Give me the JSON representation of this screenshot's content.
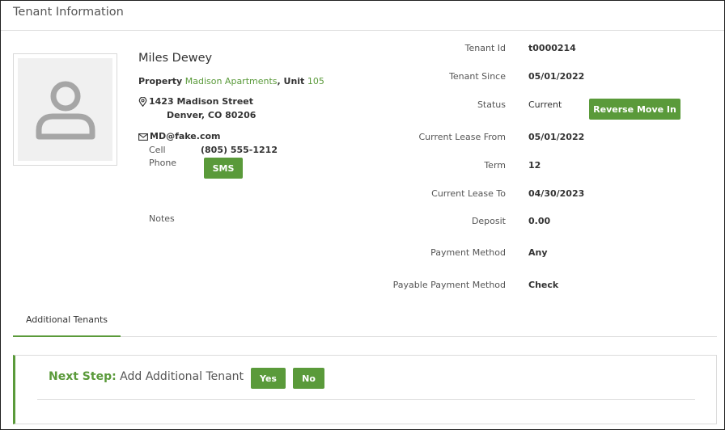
{
  "header": {
    "title": "Tenant Information"
  },
  "profile": {
    "name": "Miles Dewey",
    "property_label": "Property",
    "property_name": "Madison Apartments",
    "unit_label": ", Unit",
    "unit_number": "105",
    "address_line1": "1423 Madison Street",
    "address_line2": "Denver, CO 80206",
    "email": "MD@fake.com",
    "cell_label": "Cell",
    "cell_value": "(805) 555-1212",
    "phone_label": "Phone",
    "sms_button": "SMS",
    "notes_label": "Notes"
  },
  "details": [
    {
      "label": "Tenant Id",
      "value": "t0000214"
    },
    {
      "label": "Tenant Since",
      "value": "05/01/2022"
    },
    {
      "label": "Status",
      "value": "Current"
    },
    {
      "label": "Current Lease From",
      "value": "05/01/2022"
    },
    {
      "label": "Term",
      "value": "12"
    },
    {
      "label": "Current Lease To",
      "value": "04/30/2023"
    },
    {
      "label": "Deposit",
      "value": "0.00"
    },
    {
      "label": "Payment Method",
      "value": "Any"
    },
    {
      "label": "Payable Payment Method",
      "value": "Check"
    }
  ],
  "status_action": {
    "button": "Reverse Move In"
  },
  "tabs": [
    {
      "label": "Additional Tenants"
    }
  ],
  "next_step": {
    "label": "Next Step:",
    "text": "Add Additional Tenant",
    "yes_button": "Yes",
    "no_button": "No"
  },
  "colors": {
    "accent": "#5a9a3a",
    "border": "#dcdcdc",
    "placeholder_bg": "#f0f0f0",
    "placeholder_icon": "#a6a6a6"
  },
  "icons": [
    "person-placeholder-icon",
    "map-pin-icon",
    "envelope-icon"
  ]
}
